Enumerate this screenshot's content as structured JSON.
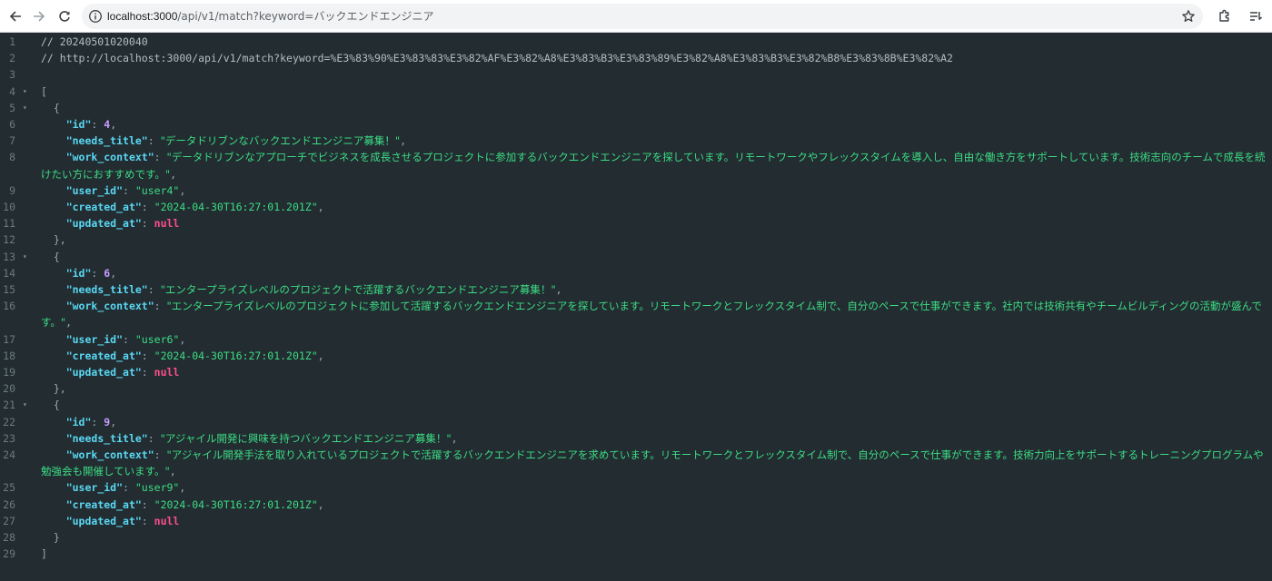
{
  "browser": {
    "url_host": "localhost:3000",
    "url_path": "/api/v1/match?keyword=バックエンドエンジニア"
  },
  "comments": {
    "timestamp": "// 20240501020040",
    "request_url": "// http://localhost:3000/api/v1/match?keyword=%E3%83%90%E3%83%83%E3%82%AF%E3%82%A8%E3%83%B3%E3%83%89%E3%82%A8%E3%83%B3%E3%82%B8%E3%83%8B%E3%82%A2"
  },
  "records": [
    {
      "id": "4",
      "needs_title": "\"データドリブンなバックエンドエンジニア募集！\"",
      "work_context": "\"データドリブンなアプローチでビジネスを成長させるプロジェクトに参加するバックエンドエンジニアを探しています。リモートワークやフレックスタイムを導入し、自由な働き方をサポートしています。技術志向のチームで成長を続けたい方におすすめです。\"",
      "user_id": "\"user4\"",
      "created_at": "\"2024-04-30T16:27:01.201Z\"",
      "updated_at": "null"
    },
    {
      "id": "6",
      "needs_title": "\"エンタープライズレベルのプロジェクトで活躍するバックエンドエンジニア募集！\"",
      "work_context": "\"エンタープライズレベルのプロジェクトに参加して活躍するバックエンドエンジニアを探しています。リモートワークとフレックスタイム制で、自分のペースで仕事ができます。社内では技術共有やチームビルディングの活動が盛んです。\"",
      "user_id": "\"user6\"",
      "created_at": "\"2024-04-30T16:27:01.201Z\"",
      "updated_at": "null"
    },
    {
      "id": "9",
      "needs_title": "\"アジャイル開発に興味を持つバックエンドエンジニア募集！\"",
      "work_context": "\"アジャイル開発手法を取り入れているプロジェクトで活躍するバックエンドエンジニアを求めています。リモートワークとフレックスタイム制で、自分のペースで仕事ができます。技術力向上をサポートするトレーニングプログラムや勉強会も開催しています。\"",
      "user_id": "\"user9\"",
      "created_at": "\"2024-04-30T16:27:01.201Z\"",
      "updated_at": "null"
    }
  ],
  "keys": {
    "id": "\"id\"",
    "needs_title": "\"needs_title\"",
    "work_context": "\"work_context\"",
    "user_id": "\"user_id\"",
    "created_at": "\"created_at\"",
    "updated_at": "\"updated_at\""
  },
  "syntax": {
    "open_bracket": "[",
    "close_bracket": "]",
    "open_brace": "{",
    "close_brace": "}",
    "close_brace_comma": "},",
    "colon": ": ",
    "comma": ","
  },
  "line_numbers": [
    "1",
    "2",
    "3",
    "4",
    "5",
    "6",
    "7",
    "8",
    "9",
    "10",
    "11",
    "12",
    "13",
    "14",
    "15",
    "16",
    "17",
    "18",
    "19",
    "20",
    "21",
    "22",
    "23",
    "24",
    "25",
    "26",
    "27",
    "28",
    "29"
  ],
  "fold_glyph": "▾",
  "colors": {
    "background": "#222c31",
    "key": "#5ad8f3",
    "string": "#3ddc84",
    "number": "#c99bff",
    "null": "#ff4f8b"
  },
  "icons": [
    "back-arrow-icon",
    "forward-arrow-icon",
    "reload-icon",
    "info-icon",
    "star-icon",
    "extensions-icon",
    "reading-list-icon"
  ]
}
